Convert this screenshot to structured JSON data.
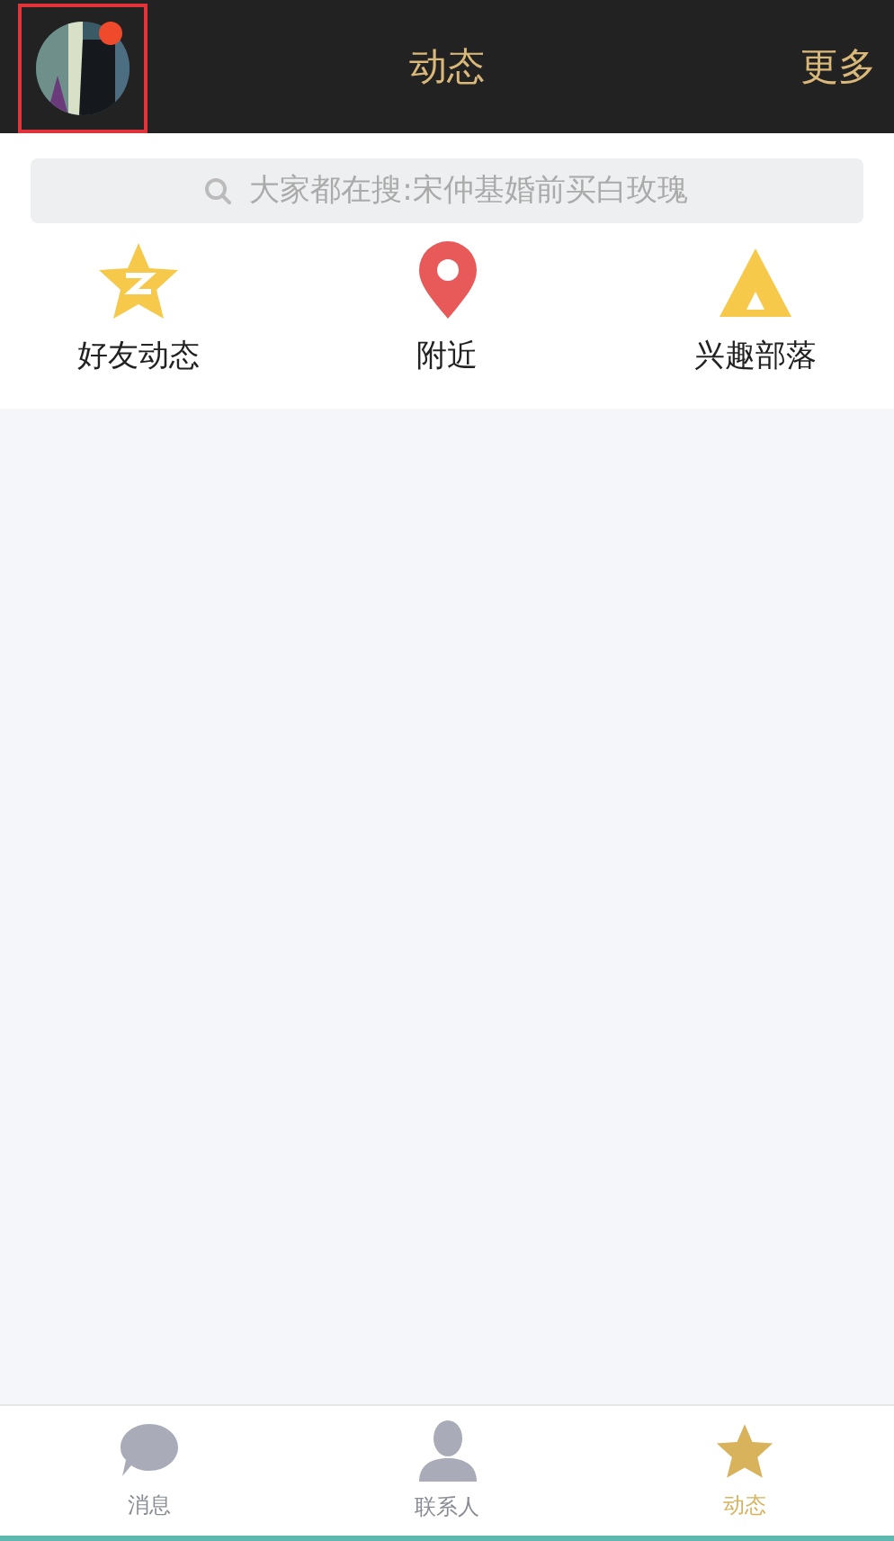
{
  "header": {
    "avatar": {
      "unread": true
    },
    "title": "动态",
    "more": "更多"
  },
  "search": {
    "placeholder": "大家都在搜:宋仲基婚前买白玫瑰"
  },
  "shortcuts": [
    {
      "kind": "star",
      "label": "好友动态"
    },
    {
      "kind": "pin",
      "label": "附近"
    },
    {
      "kind": "tent",
      "label": "兴趣部落"
    }
  ],
  "tabs": [
    {
      "kind": "chat",
      "label": "消息",
      "selected": false
    },
    {
      "kind": "person",
      "label": "联系人",
      "selected": false
    },
    {
      "kind": "star",
      "label": "动态",
      "selected": true
    }
  ]
}
